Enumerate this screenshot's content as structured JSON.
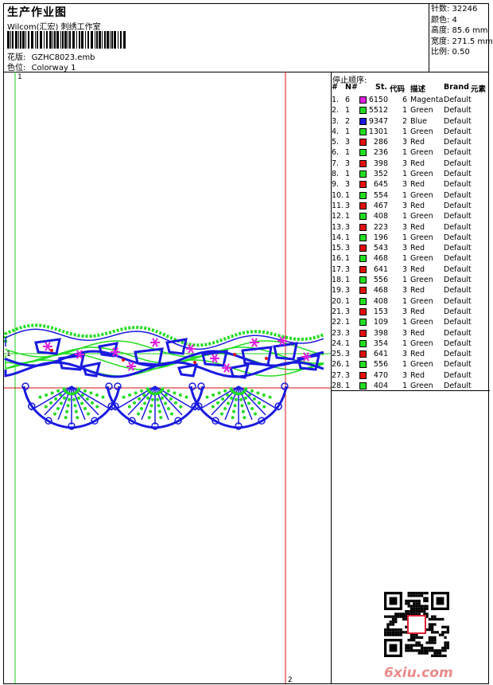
{
  "header": {
    "title": "生产作业图",
    "company": "Wilcom(汇宏) 刺绣工作室",
    "design_label": "花版:",
    "design_value": "GZHC8023.emb",
    "colorway_label": "色位:",
    "colorway_value": "Colorway 1"
  },
  "stats": {
    "stitches": "针数: 32246",
    "colors": "颜色: 4",
    "height": "高度: 85.6 mm",
    "width": "宽度: 271.5 mm",
    "scale": "比例: 0.50"
  },
  "design": {
    "marker_1": "1",
    "marker_1b": "1",
    "marker_2": "2"
  },
  "stops": {
    "title": "停止顺序:",
    "headers": {
      "num": "#",
      "n": "N#",
      "st": "St.",
      "code": "代码",
      "desc": "描述",
      "brand": "Brand",
      "elem": "元素"
    },
    "rows": [
      {
        "num": "1.",
        "n": "6",
        "color": "#e020e0",
        "st": "6150",
        "code": "6",
        "desc": "Magenta",
        "brand": "Default"
      },
      {
        "num": "2.",
        "n": "1",
        "color": "#22dd22",
        "st": "5512",
        "code": "1",
        "desc": "Green",
        "brand": "Default"
      },
      {
        "num": "3.",
        "n": "2",
        "color": "#1a1ae0",
        "st": "9347",
        "code": "2",
        "desc": "Blue",
        "brand": "Default"
      },
      {
        "num": "4.",
        "n": "1",
        "color": "#22dd22",
        "st": "1301",
        "code": "1",
        "desc": "Green",
        "brand": "Default"
      },
      {
        "num": "5.",
        "n": "3",
        "color": "#e01010",
        "st": "286",
        "code": "3",
        "desc": "Red",
        "brand": "Default"
      },
      {
        "num": "6.",
        "n": "1",
        "color": "#22dd22",
        "st": "236",
        "code": "1",
        "desc": "Green",
        "brand": "Default"
      },
      {
        "num": "7.",
        "n": "3",
        "color": "#e01010",
        "st": "398",
        "code": "3",
        "desc": "Red",
        "brand": "Default"
      },
      {
        "num": "8.",
        "n": "1",
        "color": "#22dd22",
        "st": "352",
        "code": "1",
        "desc": "Green",
        "brand": "Default"
      },
      {
        "num": "9.",
        "n": "3",
        "color": "#e01010",
        "st": "645",
        "code": "3",
        "desc": "Red",
        "brand": "Default"
      },
      {
        "num": "10.",
        "n": "1",
        "color": "#22dd22",
        "st": "554",
        "code": "1",
        "desc": "Green",
        "brand": "Default"
      },
      {
        "num": "11.",
        "n": "3",
        "color": "#e01010",
        "st": "467",
        "code": "3",
        "desc": "Red",
        "brand": "Default"
      },
      {
        "num": "12.",
        "n": "1",
        "color": "#22dd22",
        "st": "408",
        "code": "1",
        "desc": "Green",
        "brand": "Default"
      },
      {
        "num": "13.",
        "n": "3",
        "color": "#e01010",
        "st": "223",
        "code": "3",
        "desc": "Red",
        "brand": "Default"
      },
      {
        "num": "14.",
        "n": "1",
        "color": "#22dd22",
        "st": "196",
        "code": "1",
        "desc": "Green",
        "brand": "Default"
      },
      {
        "num": "15.",
        "n": "3",
        "color": "#e01010",
        "st": "543",
        "code": "3",
        "desc": "Red",
        "brand": "Default"
      },
      {
        "num": "16.",
        "n": "1",
        "color": "#22dd22",
        "st": "468",
        "code": "1",
        "desc": "Green",
        "brand": "Default"
      },
      {
        "num": "17.",
        "n": "3",
        "color": "#e01010",
        "st": "641",
        "code": "3",
        "desc": "Red",
        "brand": "Default"
      },
      {
        "num": "18.",
        "n": "1",
        "color": "#22dd22",
        "st": "556",
        "code": "1",
        "desc": "Green",
        "brand": "Default"
      },
      {
        "num": "19.",
        "n": "3",
        "color": "#e01010",
        "st": "468",
        "code": "3",
        "desc": "Red",
        "brand": "Default"
      },
      {
        "num": "20.",
        "n": "1",
        "color": "#22dd22",
        "st": "408",
        "code": "1",
        "desc": "Green",
        "brand": "Default"
      },
      {
        "num": "21.",
        "n": "3",
        "color": "#e01010",
        "st": "153",
        "code": "3",
        "desc": "Red",
        "brand": "Default"
      },
      {
        "num": "22.",
        "n": "1",
        "color": "#22dd22",
        "st": "109",
        "code": "1",
        "desc": "Green",
        "brand": "Default"
      },
      {
        "num": "23.",
        "n": "3",
        "color": "#e01010",
        "st": "398",
        "code": "3",
        "desc": "Red",
        "brand": "Default"
      },
      {
        "num": "24.",
        "n": "1",
        "color": "#22dd22",
        "st": "354",
        "code": "1",
        "desc": "Green",
        "brand": "Default"
      },
      {
        "num": "25.",
        "n": "3",
        "color": "#e01010",
        "st": "641",
        "code": "3",
        "desc": "Red",
        "brand": "Default"
      },
      {
        "num": "26.",
        "n": "1",
        "color": "#22dd22",
        "st": "556",
        "code": "1",
        "desc": "Green",
        "brand": "Default"
      },
      {
        "num": "27.",
        "n": "3",
        "color": "#e01010",
        "st": "470",
        "code": "3",
        "desc": "Red",
        "brand": "Default"
      },
      {
        "num": "28.",
        "n": "1",
        "color": "#22dd22",
        "st": "404",
        "code": "1",
        "desc": "Green",
        "brand": "Default"
      }
    ]
  },
  "watermark": "6xiu.com",
  "colors": {
    "blue": "#1a1ae0",
    "green": "#22dd22",
    "magenta": "#e020e0",
    "red": "#e01010"
  }
}
